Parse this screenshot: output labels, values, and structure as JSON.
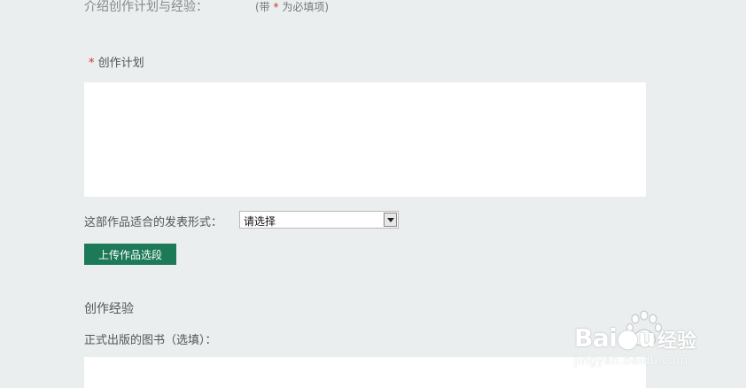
{
  "header": {
    "title": "介绍创作计划与经验：",
    "note_open": "(带",
    "note_star": "*",
    "note_rest": "为必填项)"
  },
  "plan": {
    "required_mark": "*",
    "label": "创作计划",
    "value": ""
  },
  "publish_form": {
    "label": "这部作品适合的发表形式：",
    "selected": "请选择"
  },
  "upload": {
    "label": "上传作品选段"
  },
  "experience": {
    "title": "创作经验",
    "books_label": "正式出版的图书（选填）：",
    "books_value": ""
  },
  "watermark": {
    "brand": "Bai",
    "brand_tail": "u",
    "cn": "经验",
    "site": "jingyan.baidu.com"
  },
  "colors": {
    "background": "#eaeeee",
    "button": "#1d7a58",
    "required": "#c0392b"
  }
}
